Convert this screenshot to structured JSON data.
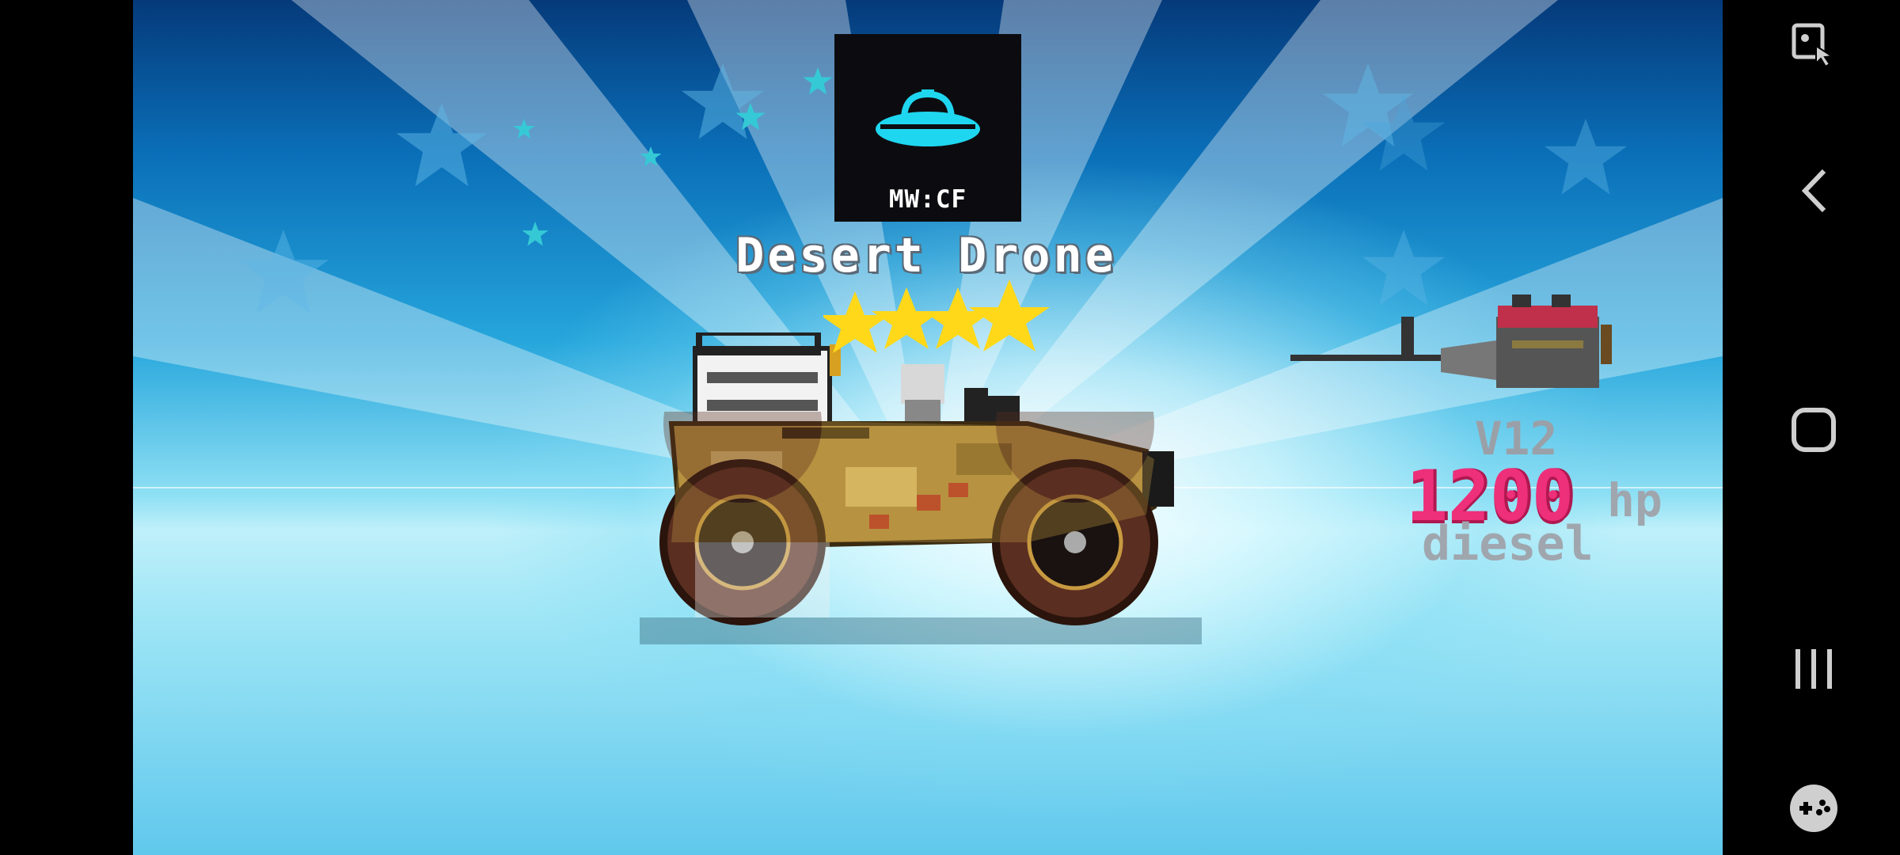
{
  "game": {
    "badge_label": "MW:CF",
    "vehicle_name": "Desert Drone",
    "star_rating": 4,
    "star_max": 4
  },
  "engine": {
    "cylinders": "V12",
    "horsepower": "1200",
    "hp_unit": "hp",
    "fuel": "diesel"
  },
  "nav": {
    "icons": [
      "screenshot-touch-icon",
      "back-icon",
      "home-icon",
      "recents-icon",
      "game-tools-icon"
    ]
  },
  "colors": {
    "accent_hp": "#ee2f7a",
    "stat_gray": "#9aa0a8",
    "star_yellow": "#ffd81a",
    "badge_bg": "#0c0c10",
    "ufo_cyan": "#1fd6f0"
  }
}
